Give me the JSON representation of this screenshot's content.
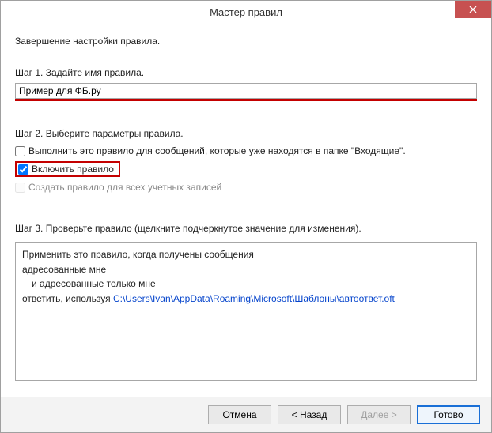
{
  "window": {
    "title": "Мастер правил"
  },
  "intro": "Завершение настройки правила.",
  "step1": {
    "label": "Шаг 1. Задайте имя правила.",
    "value": "Пример для ФБ.ру"
  },
  "step2": {
    "label": "Шаг 2. Выберите параметры правила.",
    "opt_run_inbox": {
      "label": "Выполнить это правило для сообщений, которые уже находятся в папке \"Входящие\".",
      "checked": false
    },
    "opt_enable": {
      "label": "Включить правило",
      "checked": true
    },
    "opt_all_accounts": {
      "label": "Создать правило для всех учетных записей",
      "checked": false,
      "disabled": true
    }
  },
  "step3": {
    "label": "Шаг 3. Проверьте правило (щелкните подчеркнутое значение для изменения).",
    "line1": "Применить это правило, когда получены сообщения",
    "line2": "адресованные мне",
    "line3": "и адресованные только мне",
    "line4_prefix": "ответить, используя ",
    "line4_link": "C:\\Users\\Ivan\\AppData\\Roaming\\Microsoft\\Шаблоны\\автоответ.oft"
  },
  "footer": {
    "cancel": "Отмена",
    "back": "< Назад",
    "next": "Далее >",
    "finish": "Готово"
  }
}
